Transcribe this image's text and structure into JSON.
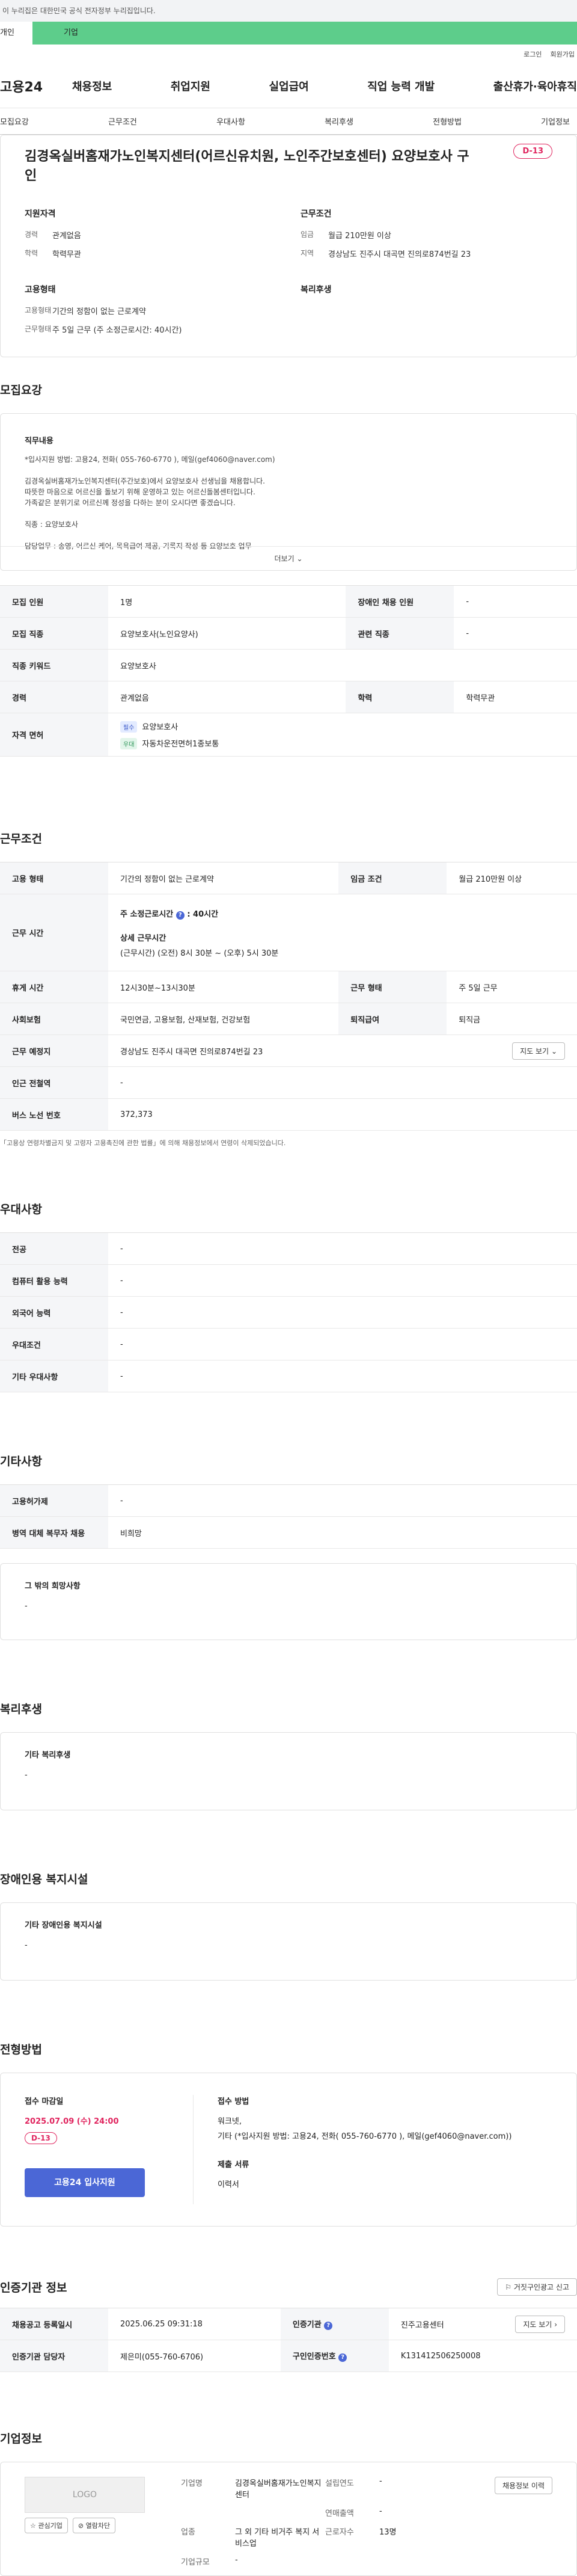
{
  "gov_banner": "이 누리집은 대한민국 공식 전자정부 누리집입니다.",
  "tabs": {
    "personal": "개인",
    "company": "기업"
  },
  "util": {
    "login": "로그인",
    "join": "회원가입"
  },
  "logo": "고용24",
  "gnb": [
    "채용정보",
    "취업지원",
    "실업급여",
    "직업 능력 개발",
    "출산휴가·육아휴직"
  ],
  "anchors": [
    "모집요강",
    "근무조건",
    "우대사항",
    "복리후생",
    "전형방법",
    "기업정보"
  ],
  "summary": {
    "title": "김경옥실버홈재가노인복지센터(어르신유치원, 노인주간보호센터) 요양보호사 구인",
    "dday": "D-13",
    "qual_title": "지원자격",
    "career_k": "경력",
    "career_v": "관계없음",
    "edu_k": "학력",
    "edu_v": "학력무관",
    "cond_title": "근무조건",
    "wage_k": "임금",
    "wage_v": "월급 210만원 이상",
    "region_k": "지역",
    "region_v": "경상남도 진주시 대곡면 진의로874번길 23",
    "emp_title": "고용형태",
    "emptype_k": "고용형태",
    "emptype_v": "기간의 정함이 없는 근로계약",
    "worktype_k": "근무형태",
    "worktype_v": "주 5일 근무 (주 소정근로시간: 40시간)",
    "welfare_title": "복리후생"
  },
  "recruit": {
    "title": "모집요강",
    "duty_title": "직무내용",
    "lines": [
      "*입사지원 방법: 고용24, 전화( 055-760-6770 ), 메일(gef4060@naver.com)",
      "김경옥실버홈재가노인복지센터(주간보호)에서 요양보호사 선생님을 채용합니다.",
      "따뜻한 마음으로 어르신을 돌보기 위해 운영하고 있는 어르신돌봄센터입니다.",
      "가족같은 분위기로 어르신께 정성을 다하는 분이 오시다면 좋겠습니다.",
      "직종 : 요양보호사",
      "담당업무 : 송영, 어르신 케어, 목욕급여 제공, 기록지 작성 등 요양보호 업무"
    ],
    "more": "더보기",
    "count_k": "모집 인원",
    "count_v": "1명",
    "disabled_k": "장애인 채용 인원",
    "disabled_v": "-",
    "job_k": "모집 직종",
    "job_v": "요양보호사(노인요양사)",
    "rel_k": "관련 직종",
    "rel_v": "-",
    "kw_k": "직종 키워드",
    "kw_v": "요양보호사",
    "car_k": "경력",
    "car_v": "관계없음",
    "edu_k": "학력",
    "edu_v": "학력무관",
    "lic_k": "자격 면허",
    "lic1_tag": "필수",
    "lic1_v": "요양보호사",
    "lic2_tag": "우대",
    "lic2_v": "자동차운전면허1종보통"
  },
  "work": {
    "title": "근무조건",
    "emp_k": "고용 형태",
    "emp_v": "기간의 정함이 없는 근로계약",
    "wage_k": "임금 조건",
    "wage_v": "월급 210만원 이상",
    "time_k": "근무 시간",
    "week_label": "주 소정근로시간",
    "week_v": ": 40시간",
    "detail_label": "상세 근무시간",
    "detail_v": "(근무시간) (오전) 8시 30분 ~ (오후) 5시 30분",
    "rest_k": "휴게 시간",
    "rest_v": "12시30분~13시30분",
    "form_k": "근무 형태",
    "form_v": "주 5일 근무",
    "ins_k": "사회보험",
    "ins_v": "국민연금, 고용보험, 산재보험, 건강보험",
    "ret_k": "퇴직급여",
    "ret_v": "퇴직금",
    "place_k": "근무 예정지",
    "place_v": "경상남도 진주시 대곡면 진의로874번길 23",
    "map_btn": "지도 보기",
    "subway_k": "인근 전철역",
    "subway_v": "-",
    "bus_k": "버스 노선 번호",
    "bus_v": "372,373",
    "note": "「고용상 연령차별금지 및 고령자 고용촉진에 관한 법률」에 의해 채용정보에서 연령이 삭제되었습니다."
  },
  "pref": {
    "title": "우대사항",
    "rows": [
      [
        "전공",
        "-"
      ],
      [
        "컴퓨터 활용 능력",
        "-"
      ],
      [
        "외국어 능력",
        "-"
      ],
      [
        "우대조건",
        "-"
      ],
      [
        "기타 우대사항",
        "-"
      ]
    ]
  },
  "etc": {
    "title": "기타사항",
    "rows": [
      [
        "고용허가제",
        "-"
      ],
      [
        "병역 대체 복무자 채용",
        "비희망"
      ]
    ],
    "wish_title": "그 밖의 희망사항",
    "wish_v": "-"
  },
  "welfare": {
    "title": "복리후생",
    "sub": "기타 복리후생",
    "v": "-"
  },
  "disab": {
    "title": "장애인용 복지시설",
    "sub": "기타 장애인용 복지시설",
    "v": "-"
  },
  "process": {
    "title": "전형방법",
    "deadline_label": "접수 마감일",
    "deadline": "2025.07.09 (수) 24:00",
    "dday": "D-13",
    "apply": "고용24 입사지원",
    "method_label": "접수 방법",
    "method_1": "워크넷,",
    "method_2": "기타 (*입사지원 방법: 고용24, 전화( 055-760-6770 ), 메일(gef4060@naver.com))",
    "docs_label": "제출 서류",
    "docs_v": "이력서"
  },
  "auth": {
    "title": "인증기관 정보",
    "report_btn": "거짓구인광고 신고",
    "reg_k": "채용공고 등록일시",
    "reg_v": "2025.06.25 09:31:18",
    "org_k": "인증기관",
    "org_v": "진주고용센터",
    "map_btn": "지도 보기",
    "mgr_k": "인증기관 담당자",
    "mgr_v": "제은미(055-760-6706)",
    "biz_k": "구인인증번호",
    "biz_v": "K131412506250008"
  },
  "company": {
    "title": "기업정보",
    "logo": "LOGO",
    "fav": "관심기업",
    "block": "열람차단",
    "name_k": "기업명",
    "name_v": "김경옥실버홈재가노인복지센터",
    "found_k": "설립연도",
    "found_v": "-",
    "sales_k": "연매출액",
    "sales_v": "-",
    "ind_k": "업종",
    "ind_v": "그 외 기타 비거주 복지 서비스업",
    "staff_k": "근로자수",
    "staff_v": "13명",
    "size_k": "기업규모",
    "size_v": "-",
    "jobs_btn": "채용정보 이력"
  }
}
